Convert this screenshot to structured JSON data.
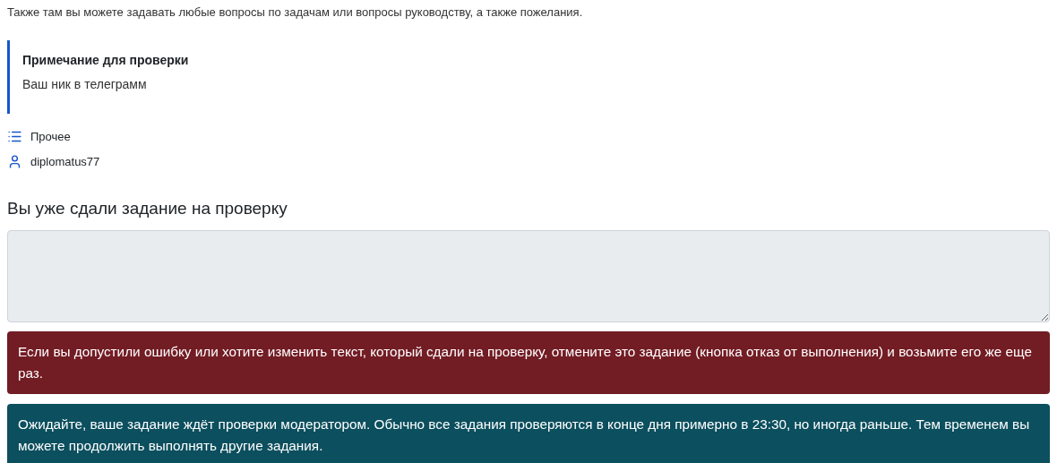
{
  "intro": "Также там вы можете задавать любые вопросы по задачам или вопросы руководству, а также пожелания.",
  "note": {
    "title": "Примечание для проверки",
    "text": "Ваш ник в телеграмм"
  },
  "meta": [
    {
      "kind": "list",
      "text": "Прочее"
    },
    {
      "kind": "user",
      "text": "diplomatus77"
    }
  ],
  "submission": {
    "heading": "Вы уже сдали задание на проверку",
    "disabled": true
  },
  "alerts": [
    {
      "kind": "danger",
      "text": "Если вы допустили ошибку или хотите изменить текст, который сдали на проверку, отмените это задание (кнопка отказ от выполнения) и возьмите его же еще раз."
    },
    {
      "kind": "info",
      "text": "Ожидайте, ваше задание ждёт проверки модератором. Обычно все задания проверяются в конце дня примерно в 23:30, но иногда раньше. Тем временем вы можете продолжить выполнять другие задания."
    }
  ]
}
